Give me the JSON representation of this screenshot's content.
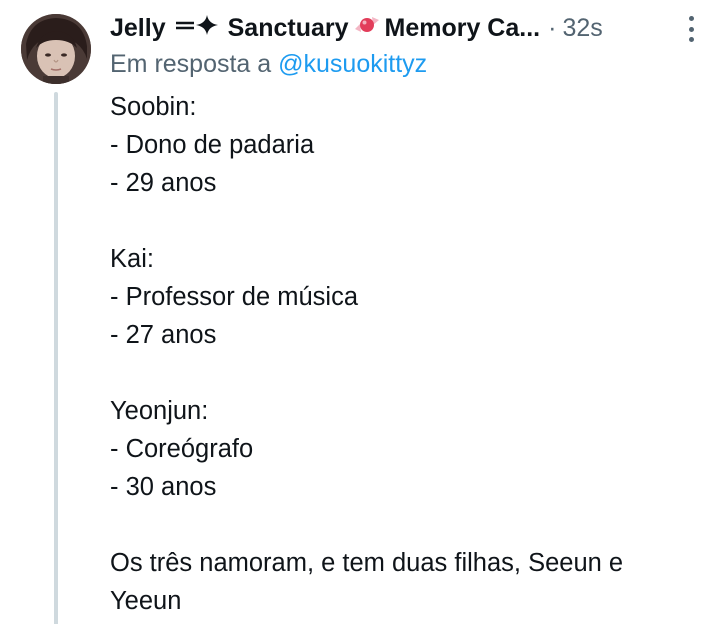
{
  "author": {
    "name_part1": "Jelly",
    "name_deco": "═✦",
    "name_part2": "Sanctuary",
    "name_candy": "🍬",
    "name_part3": "Memory Ca...",
    "separator": "·",
    "timestamp": "32s"
  },
  "reply": {
    "prefix": "Em resposta a",
    "handle": "@kusuokittyz"
  },
  "body_lines": [
    "Soobin:",
    "- Dono de padaria",
    "- 29 anos",
    "",
    "Kai:",
    "- Professor de música",
    "- 27 anos",
    "",
    "Yeonjun:",
    "- Coreógrafo",
    "- 30 anos",
    "",
    "Os três namoram, e tem duas filhas, Seeun e Yeeun"
  ],
  "icons": {
    "more": "more-vertical-icon",
    "avatar": "user-avatar"
  },
  "colors": {
    "text": "#0f1419",
    "secondary": "#536471",
    "link": "#1d9bf0",
    "thread_line": "#cfd9de"
  }
}
